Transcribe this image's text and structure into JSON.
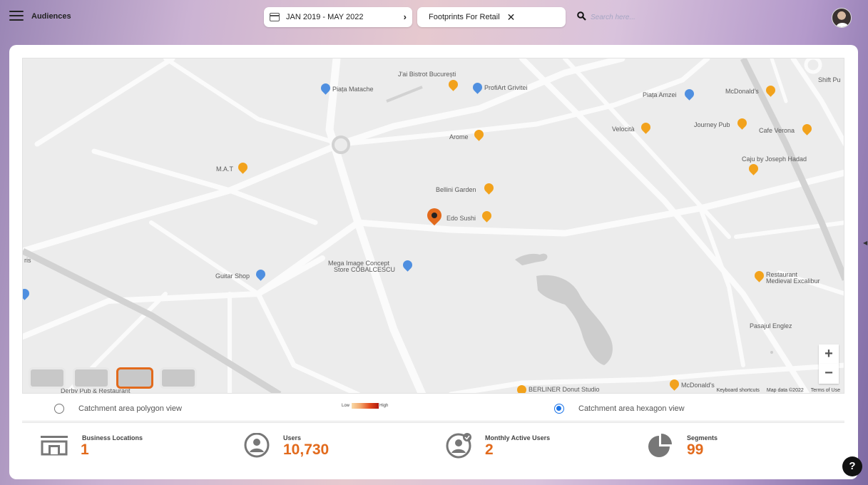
{
  "header": {
    "menu_icon": "hamburger-icon",
    "title": "Audiences",
    "date_range": "JAN 2019 - MAY 2022",
    "filter_chip": "Footprints For Retail",
    "search_placeholder": "Search here...",
    "avatar_icon": "user-avatar"
  },
  "map": {
    "places": [
      {
        "label": "J'ai Bistrot București"
      },
      {
        "label": "Piața Matache"
      },
      {
        "label": "ProfiArt Grivitei"
      },
      {
        "label": "Piața Amzei"
      },
      {
        "label": "McDonald's"
      },
      {
        "label": "Shift Pu"
      },
      {
        "label": "Arome"
      },
      {
        "label": "Velocità"
      },
      {
        "label": "Journey Pub"
      },
      {
        "label": "Cafe Verona"
      },
      {
        "label": "Caju by Joseph Hadad"
      },
      {
        "label": "M.A.T"
      },
      {
        "label": "Bellini Garden"
      },
      {
        "label": "Edo Sushi"
      },
      {
        "label": "Mega Image Concept"
      },
      {
        "label": "Store COBALCESCU"
      },
      {
        "label": "Guitar Shop"
      },
      {
        "label": "Restaurant"
      },
      {
        "label": "Medieval Excalibur"
      },
      {
        "label": "Pasajul Englez"
      },
      {
        "label": "BERLINER Donut Studio"
      },
      {
        "label": "McDonald's"
      },
      {
        "label": "Derby Pub & Restaurant"
      },
      {
        "label": "ris"
      }
    ],
    "zoom_in": "+",
    "zoom_out": "−",
    "footer": {
      "shortcuts": "Keyboard shortcuts",
      "data": "Map data ©2022",
      "terms": "Terms of Use"
    },
    "layer_thumbnails_selected": 3
  },
  "views": {
    "polygon_label": "Catchment area polygon view",
    "hexagon_label": "Catchment area hexagon view",
    "selected": "hexagon",
    "legend_low": "Low",
    "legend_high": "High"
  },
  "stats": [
    {
      "label": "Business Locations",
      "value": "1",
      "icon": "building-icon"
    },
    {
      "label": "Users",
      "value": "10,730",
      "icon": "user-circle-icon"
    },
    {
      "label": "Monthly Active Users",
      "value": "2",
      "icon": "active-user-icon"
    },
    {
      "label": "Segments",
      "value": "99",
      "icon": "pie-chart-icon"
    }
  ],
  "help": "?",
  "colors": {
    "accent": "#e26a1c",
    "radio_selected": "#1a73e8",
    "food_pin": "#f2a21c",
    "shop_pin": "#4f8fe0"
  }
}
